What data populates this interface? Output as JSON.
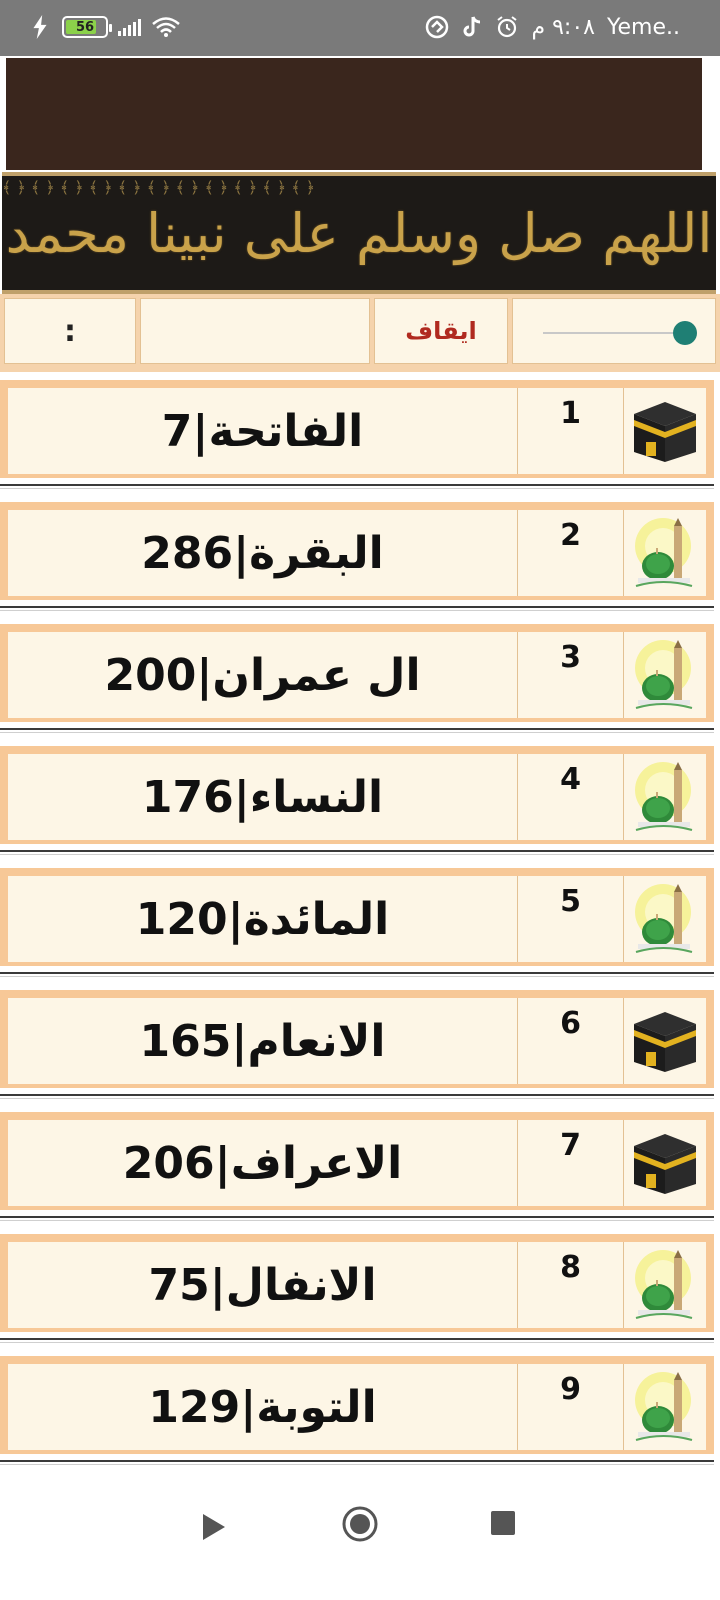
{
  "status_bar": {
    "battery_level": "56",
    "time": "٩:٠٨ م",
    "carrier": "Yeme..",
    "icons": [
      "charging-icon",
      "battery-icon",
      "signal-icon",
      "wifi-icon",
      "app-icon",
      "tiktok-icon",
      "alarm-icon"
    ]
  },
  "header": {
    "banner_text": "اللهم صل وسلم على نبينا محمد"
  },
  "controls": {
    "menu_label": ":",
    "stop_label": "ايقاف",
    "slider_level": 1.0,
    "accent_color": "#1f7f74"
  },
  "surahs": [
    {
      "number": "1",
      "name": "الفاتحة|7",
      "icon": "kaaba-icon"
    },
    {
      "number": "2",
      "name": "البقرة|286",
      "icon": "mosque-icon"
    },
    {
      "number": "3",
      "name": "ال عمران|200",
      "icon": "mosque-icon"
    },
    {
      "number": "4",
      "name": "النساء|176",
      "icon": "mosque-icon"
    },
    {
      "number": "5",
      "name": "المائدة|120",
      "icon": "mosque-icon"
    },
    {
      "number": "6",
      "name": "الانعام|165",
      "icon": "kaaba-icon"
    },
    {
      "number": "7",
      "name": "الاعراف|206",
      "icon": "kaaba-icon"
    },
    {
      "number": "8",
      "name": "الانفال|75",
      "icon": "mosque-icon"
    },
    {
      "number": "9",
      "name": "التوبة|129",
      "icon": "mosque-icon"
    }
  ],
  "nav": {
    "icons": [
      "back-icon",
      "home-icon",
      "recents-icon"
    ]
  }
}
